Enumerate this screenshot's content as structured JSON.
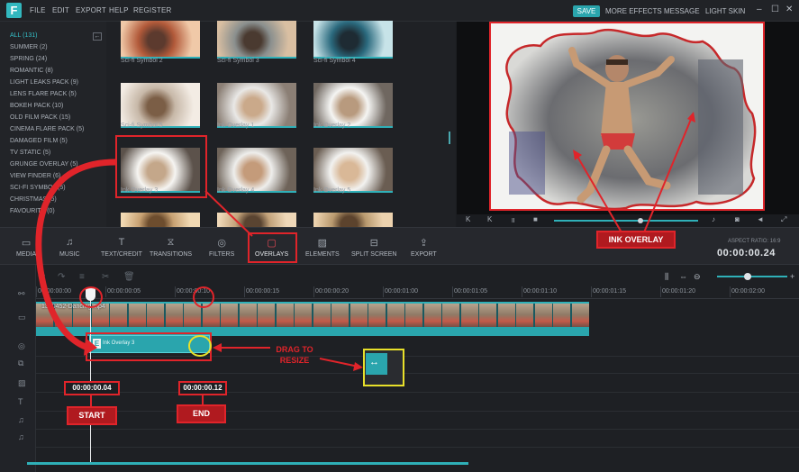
{
  "menu": {
    "items": [
      "FILE",
      "EDIT",
      "EXPORT",
      "HELP",
      "REGISTER"
    ],
    "save": "SAVE",
    "more_effects": "MORE EFFECTS",
    "message": "MESSAGE",
    "light_skin": "LIGHT SKIN",
    "logo": "F"
  },
  "categories": [
    "ALL (131)",
    "SUMMER (2)",
    "SPRING (24)",
    "ROMANTIC (8)",
    "LIGHT LEAKS PACK (9)",
    "LENS FLARE PACK (5)",
    "BOKEH PACK (10)",
    "OLD FILM PACK (15)",
    "CINEMA FLARE PACK (5)",
    "DAMAGED FILM (5)",
    "TV STATIC (5)",
    "GRUNGE OVERLAY (5)",
    "VIEW FINDER (6)",
    "SCI-FI SYMBOL (5)",
    "CHRISTMAS (5)",
    "FAVOURITE (0)"
  ],
  "thumbnails": [
    {
      "label": "Sci-fi Symbol 2"
    },
    {
      "label": "Sci-fi Symbol 3"
    },
    {
      "label": "Sci-fi Symbol 4"
    },
    {
      "label": "Sci-fi Symbol 5"
    },
    {
      "label": "Ink Overlay 1"
    },
    {
      "label": "Ink Overlay 2"
    },
    {
      "label": "Ink Overlay 3"
    },
    {
      "label": "Ink Overlay 4"
    },
    {
      "label": "Ink Overlay 5"
    },
    {
      "label": ""
    },
    {
      "label": ""
    },
    {
      "label": ""
    }
  ],
  "toolbar": {
    "media": "MEDIA",
    "music": "MUSIC",
    "text": "TEXT/CREDIT",
    "transitions": "TRANSITIONS",
    "filters": "FILTERS",
    "overlays": "OVERLAYS",
    "elements": "ELEMENTS",
    "split": "SPLIT SCREEN",
    "export": "EXPORT",
    "aspect": "ASPECT RATIO: 16:9",
    "timecode": "00:00:00.24"
  },
  "ruler": [
    "00:00:00:00",
    "00:00:00:05",
    "00:00:00:10",
    "00:00:00:15",
    "00:00:00:20",
    "00:00:01:00",
    "00:00:01:05",
    "00:00:01:10",
    "00:00:01:15",
    "00:00:01:20",
    "00:00:02:00"
  ],
  "clips": {
    "video_label": "1370452-Dancing.mp4",
    "overlay_label": "Ink Overlay 3"
  },
  "annotations": {
    "ink_overlay": "INK OVERLAY",
    "drag_line1": "DRAG TO",
    "drag_line2": "RESIZE",
    "start_time": "00:00:00.04",
    "end_time": "00:00:00.12",
    "start": "START",
    "end": "END"
  },
  "icons": {
    "back": "arrow-left-icon",
    "media": "folder-icon",
    "music": "music-note-icon",
    "text": "text-icon",
    "transitions": "transition-icon",
    "filters": "filter-icon",
    "overlays": "overlay-icon",
    "elements": "image-icon",
    "split": "split-screen-icon",
    "export": "export-icon"
  },
  "colors": {
    "accent": "#2fb0b8",
    "annotation": "#e0242a",
    "highlight": "#e8e02a"
  }
}
